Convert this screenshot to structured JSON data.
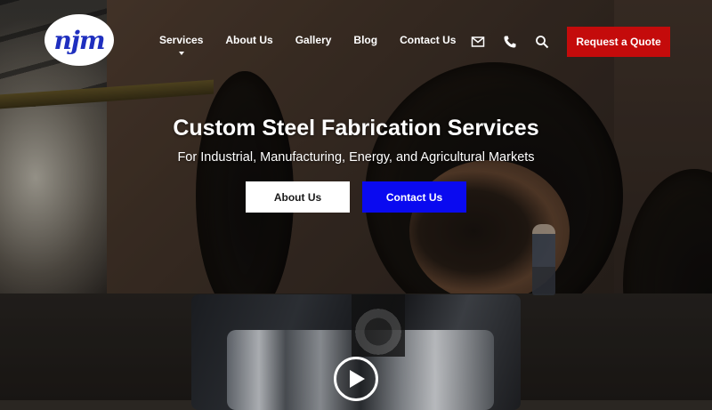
{
  "header": {
    "logo_text": "njm",
    "nav": {
      "services": "Services",
      "about": "About Us",
      "gallery": "Gallery",
      "blog": "Blog",
      "contact": "Contact Us"
    },
    "icons": {
      "mail": "mail-icon",
      "phone": "phone-icon",
      "search": "search-icon"
    },
    "quote_label": "Request a Quote"
  },
  "hero": {
    "title": "Custom Steel Fabrication Services",
    "subtitle": "For Industrial, Manufacturing, Energy, and Agricultural Markets",
    "about_label": "About Us",
    "contact_label": "Contact Us"
  },
  "colors": {
    "quote_button": "#c40b0b",
    "contact_button": "#0a0af0",
    "logo_text": "#1f2fbf"
  }
}
